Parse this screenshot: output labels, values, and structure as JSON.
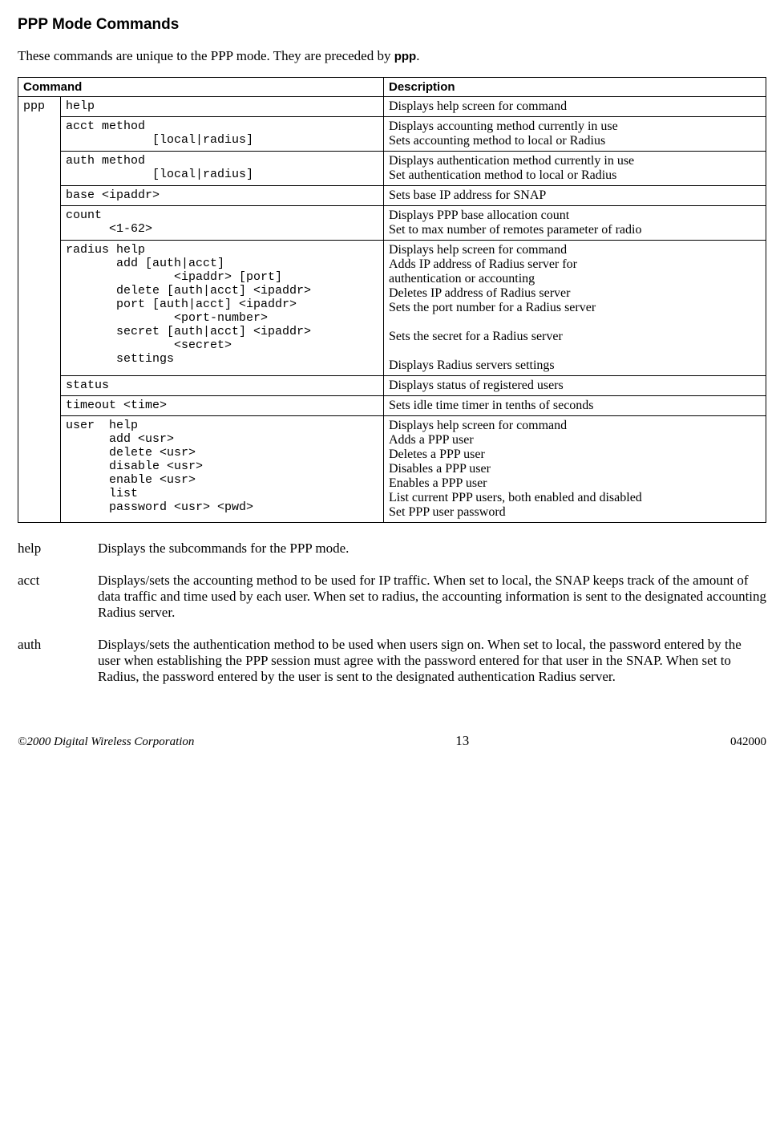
{
  "title": "PPP Mode Commands",
  "intro_part1": "These commands are unique to the PPP mode. They are preceded by ",
  "intro_bold": "ppp",
  "intro_part2": ".",
  "table": {
    "headers": {
      "command": "Command",
      "description": "Description"
    },
    "prefix": "ppp",
    "rows": [
      {
        "cmd": "help",
        "desc": "Displays help screen for command"
      },
      {
        "cmd": "acct method\n            [local|radius]",
        "desc": "Displays accounting method currently in use\nSets accounting method to local or Radius"
      },
      {
        "cmd": "auth method\n            [local|radius]",
        "desc": "Displays authentication method currently in use\nSet authentication method to local or Radius"
      },
      {
        "cmd": "base <ipaddr>",
        "desc": "Sets base IP address for SNAP"
      },
      {
        "cmd": "count\n      <1-62>",
        "desc": "Displays PPP base allocation count\nSet to max number of remotes parameter of radio"
      },
      {
        "cmd": "radius help\n       add [auth|acct]\n               <ipaddr> [port]\n       delete [auth|acct] <ipaddr>\n       port [auth|acct] <ipaddr>\n               <port-number>\n       secret [auth|acct] <ipaddr>\n               <secret>\n       settings",
        "desc": "Displays help screen for command\nAdds IP address of Radius server for\nauthentication or accounting\nDeletes IP address of Radius server\nSets the port number for a Radius server\n\nSets the secret for a Radius server\n\nDisplays Radius servers settings"
      },
      {
        "cmd": "status",
        "desc": "Displays status of registered users"
      },
      {
        "cmd": "timeout <time>",
        "desc": "Sets idle time timer in tenths of seconds"
      },
      {
        "cmd": "user  help\n      add <usr>\n      delete <usr>\n      disable <usr>\n      enable <usr>\n      list\n      password <usr> <pwd>",
        "desc": "Displays help screen for command\nAdds a PPP user\nDeletes a PPP user\nDisables a PPP user\nEnables a PPP user\nList current PPP users, both enabled and disabled\nSet PPP user password"
      }
    ]
  },
  "definitions": [
    {
      "term": "help",
      "text": "Displays the subcommands for the PPP mode."
    },
    {
      "term": "acct",
      "text": "Displays/sets the accounting method to be used for IP traffic. When set to local, the SNAP keeps track of the amount of data traffic and time used by each user. When set to radius, the accounting information is sent  to the designated accounting Radius server."
    },
    {
      "term": "auth",
      "text": "Displays/sets the authentication method to be used when users sign on. When set to local, the password entered by the user when establishing the PPP session must agree with the password entered for that user in the SNAP. When set to Radius, the password entered by the user is sent to the designated authentication Radius server."
    }
  ],
  "footer": {
    "left": "©2000 Digital Wireless Corporation",
    "center": "13",
    "right": "042000"
  }
}
